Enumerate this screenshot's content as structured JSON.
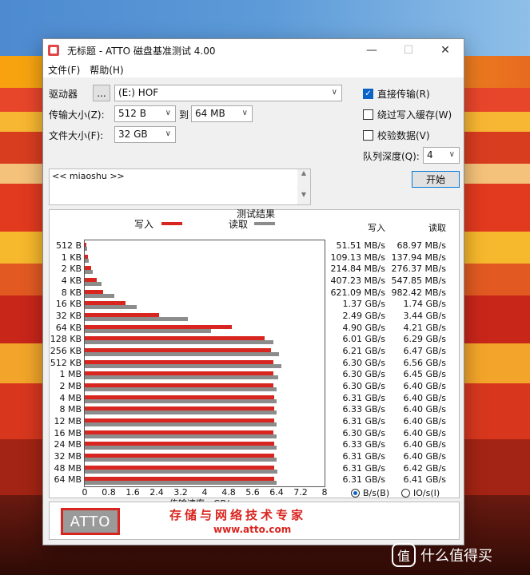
{
  "window": {
    "title": "无标题 - ATTO 磁盘基准测试 4.00"
  },
  "menu": {
    "file": "文件(F)",
    "help": "帮助(H)"
  },
  "drive": {
    "label": "驱动器",
    "browse": "...",
    "value": "(E:) HOF"
  },
  "transfer": {
    "label": "传输大小(Z):",
    "from": "512 B",
    "to_label": "到",
    "to": "64 MB"
  },
  "filesize": {
    "label": "文件大小(F):",
    "value": "32 GB"
  },
  "options": {
    "direct": "直接传输(R)",
    "direct_checked": true,
    "bypass": "绕过写入缓存(W)",
    "bypass_checked": false,
    "verify": "校验数据(V)",
    "verify_checked": false
  },
  "queue": {
    "label": "队列深度(Q):",
    "value": "4"
  },
  "start_button": "开始",
  "description": "<< miaoshu >>",
  "results": {
    "title": "测试结果",
    "write_label": "写入",
    "read_label": "读取",
    "col_write": "写入",
    "col_read": "读取",
    "xlabel": "传输速率 - GB/s",
    "rows": [
      {
        "size": "512 B",
        "write": "51.51 MB/s",
        "read": "68.97 MB/s"
      },
      {
        "size": "1 KB",
        "write": "109.13 MB/s",
        "read": "137.94 MB/s"
      },
      {
        "size": "2 KB",
        "write": "214.84 MB/s",
        "read": "276.37 MB/s"
      },
      {
        "size": "4 KB",
        "write": "407.23 MB/s",
        "read": "547.85 MB/s"
      },
      {
        "size": "8 KB",
        "write": "621.09 MB/s",
        "read": "982.42 MB/s"
      },
      {
        "size": "16 KB",
        "write": "1.37 GB/s",
        "read": "1.74 GB/s"
      },
      {
        "size": "32 KB",
        "write": "2.49 GB/s",
        "read": "3.44 GB/s"
      },
      {
        "size": "64 KB",
        "write": "4.90 GB/s",
        "read": "4.21 GB/s"
      },
      {
        "size": "128 KB",
        "write": "6.01 GB/s",
        "read": "6.29 GB/s"
      },
      {
        "size": "256 KB",
        "write": "6.21 GB/s",
        "read": "6.47 GB/s"
      },
      {
        "size": "512 KB",
        "write": "6.30 GB/s",
        "read": "6.56 GB/s"
      },
      {
        "size": "1 MB",
        "write": "6.30 GB/s",
        "read": "6.45 GB/s"
      },
      {
        "size": "2 MB",
        "write": "6.30 GB/s",
        "read": "6.40 GB/s"
      },
      {
        "size": "4 MB",
        "write": "6.31 GB/s",
        "read": "6.40 GB/s"
      },
      {
        "size": "8 MB",
        "write": "6.33 GB/s",
        "read": "6.40 GB/s"
      },
      {
        "size": "12 MB",
        "write": "6.31 GB/s",
        "read": "6.40 GB/s"
      },
      {
        "size": "16 MB",
        "write": "6.30 GB/s",
        "read": "6.40 GB/s"
      },
      {
        "size": "24 MB",
        "write": "6.33 GB/s",
        "read": "6.40 GB/s"
      },
      {
        "size": "32 MB",
        "write": "6.31 GB/s",
        "read": "6.40 GB/s"
      },
      {
        "size": "48 MB",
        "write": "6.31 GB/s",
        "read": "6.42 GB/s"
      },
      {
        "size": "64 MB",
        "write": "6.31 GB/s",
        "read": "6.41 GB/s"
      }
    ],
    "unit_bytes": "B/s(B)",
    "unit_io": "IO/s(I)",
    "unit_bytes_selected": true
  },
  "chart_data": {
    "type": "bar",
    "xlabel": "传输速率 - GB/s",
    "xlim": [
      0,
      8
    ],
    "xticks": [
      "0",
      "0.8",
      "1.6",
      "2.4",
      "3.2",
      "4",
      "4.8",
      "5.6",
      "6.4",
      "7.2",
      "8"
    ],
    "categories": [
      "512 B",
      "1 KB",
      "2 KB",
      "4 KB",
      "8 KB",
      "16 KB",
      "32 KB",
      "64 KB",
      "128 KB",
      "256 KB",
      "512 KB",
      "1 MB",
      "2 MB",
      "4 MB",
      "8 MB",
      "12 MB",
      "16 MB",
      "24 MB",
      "32 MB",
      "48 MB",
      "64 MB"
    ],
    "series": [
      {
        "name": "写入",
        "color": "#d9251f",
        "values": [
          0.0515,
          0.109,
          0.215,
          0.407,
          0.621,
          1.37,
          2.49,
          4.9,
          6.01,
          6.21,
          6.3,
          6.3,
          6.3,
          6.31,
          6.33,
          6.31,
          6.3,
          6.33,
          6.31,
          6.31,
          6.31
        ]
      },
      {
        "name": "读取",
        "color": "#8c8c8c",
        "values": [
          0.069,
          0.138,
          0.276,
          0.548,
          0.982,
          1.74,
          3.44,
          4.21,
          6.29,
          6.47,
          6.56,
          6.45,
          6.4,
          6.4,
          6.4,
          6.4,
          6.4,
          6.4,
          6.4,
          6.42,
          6.41
        ]
      }
    ],
    "legend": "top"
  },
  "banner": {
    "logo": "ATTO",
    "slogan": "存储与网络技术专家",
    "url": "www.atto.com"
  },
  "watermark": {
    "text": "什么值得买",
    "icon": "值"
  }
}
